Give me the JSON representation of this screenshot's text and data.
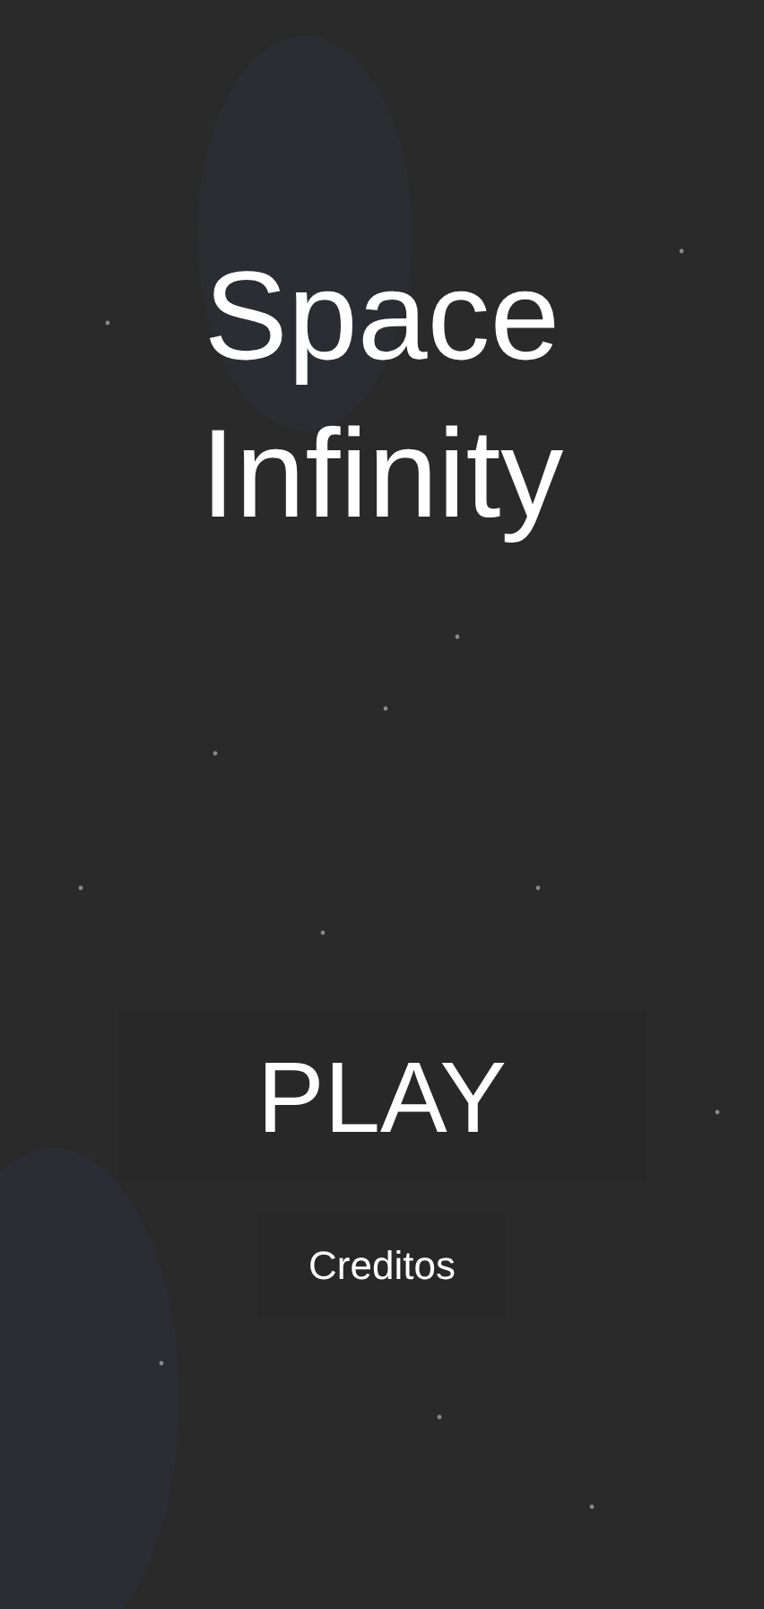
{
  "title": "Space Infinity",
  "buttons": [
    {
      "label": "PLAY",
      "kind": "primary"
    },
    {
      "label": "Creditos",
      "kind": "secondary"
    }
  ]
}
